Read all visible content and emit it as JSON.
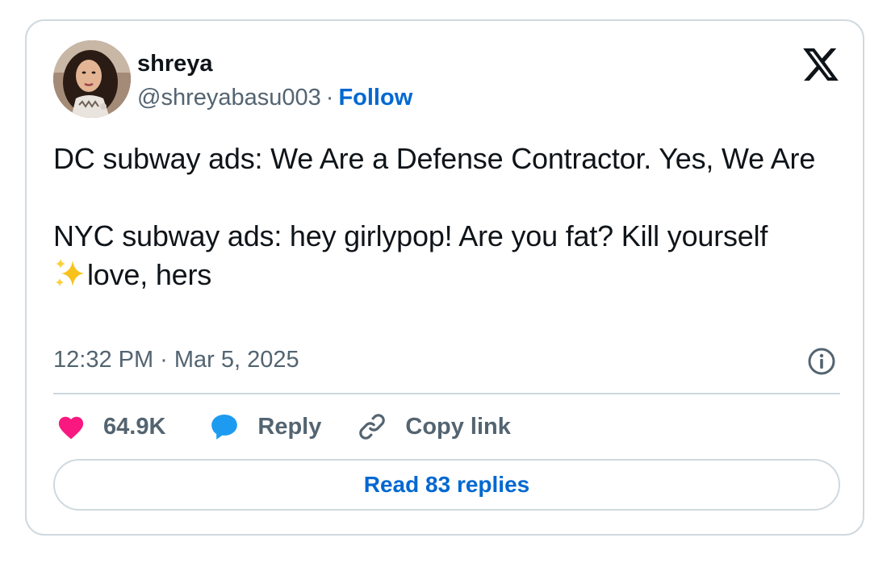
{
  "user": {
    "display_name": "shreya",
    "handle": "@shreyabasu003",
    "separator": "·",
    "follow_label": "Follow",
    "avatar_icon": "profile-photo"
  },
  "tweet": {
    "line1": "DC subway ads: We Are a Defense Contractor. Yes, We Are",
    "line2": "NYC subway ads: hey girlypop! Are you fat? Kill yourself",
    "line3_emoji": "sparkles",
    "line3": "love, hers",
    "timestamp": "12:32 PM · Mar 5, 2025"
  },
  "actions": {
    "like_count": "64.9K",
    "reply_label": "Reply",
    "copy_link_label": "Copy link"
  },
  "read_replies_label": "Read 83 replies",
  "colors": {
    "text_primary": "#0f1419",
    "text_secondary": "#536471",
    "link_blue": "#0068d1",
    "heart_pink": "#f91880",
    "reply_blue": "#1d9bf0",
    "border": "#cfd9de",
    "sparkle_yellow": "#f7c21b"
  }
}
